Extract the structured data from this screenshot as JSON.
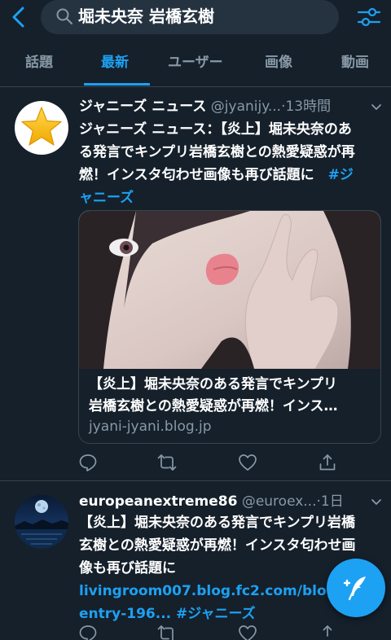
{
  "search": {
    "query": "堀未央奈 岩橋玄樹"
  },
  "tabs": [
    {
      "label": "話題"
    },
    {
      "label": "最新"
    },
    {
      "label": "ユーザー"
    },
    {
      "label": "画像"
    },
    {
      "label": "動画"
    }
  ],
  "active_tab": "最新",
  "tweets": [
    {
      "name": "ジャニーズ ニュース",
      "handle": "@jyanijy...",
      "time": "·13時間",
      "body_line1": "ジャニーズ ニュース：【炎上】堀未央奈のあ",
      "body_line2": "る発言でキンプリ岩橋玄樹との熱愛疑惑が再",
      "body_line3a": "燃！インスタ匂わせ画像も再び話題に　",
      "body_tag_a": "#ジ",
      "body_tag_b": "ャニーズ",
      "card": {
        "title_line1": "【炎上】堀未央奈のある発言でキンプリ",
        "title_line2": "岩橋玄樹との熱愛疑惑が再燃！インス…",
        "url": "jyani-jyani.blog.jp"
      }
    },
    {
      "name": "europeanextreme86",
      "handle": "@euroex...",
      "time": "·1日",
      "body_line1": "【炎上】堀未央奈のある発言でキンプリ岩橋",
      "body_line2": "玄樹との熱愛疑惑が再燃！インスタ匂わせ画",
      "body_line3": "像も再び話題に",
      "link_line1": "livingroom007.blog.fc2.com/blog",
      "link_line2": "entry-196...",
      "tag": " #ジャニーズ"
    }
  ],
  "colors": {
    "background": "#15202b",
    "accent": "#1da1f2",
    "muted": "#8899a6",
    "divider": "#38444d"
  },
  "icons": [
    "back-arrow-icon",
    "search-icon",
    "filter-sliders-icon",
    "star-icon",
    "chevron-down-icon",
    "reply-icon",
    "retweet-icon",
    "like-icon",
    "share-icon",
    "compose-icon"
  ]
}
